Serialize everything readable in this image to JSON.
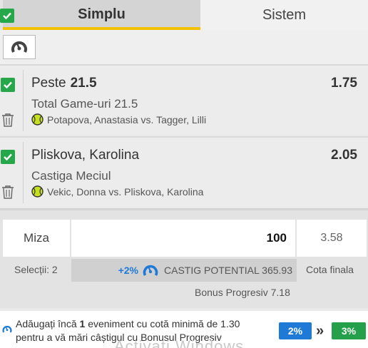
{
  "tabs": {
    "active": "Simplu",
    "inactive": "Sistem"
  },
  "icons": {
    "speed": "speedometer-icon",
    "trash": "trash-icon",
    "sport": "tennis-ball-icon",
    "check": "checkmark-icon",
    "chevron": "double-chevron-right-icon"
  },
  "colors": {
    "accent_yellow": "#f2c200",
    "check_green": "#26a84a",
    "blue": "#1e7ad6",
    "green": "#24a04a",
    "tennis_ball": "#c7e01f"
  },
  "bets": [
    {
      "selection": "Peste",
      "selection_value": "21.5",
      "odds": "1.75",
      "market": "Total Game-uri 21.5",
      "match": "Potapova, Anastasia vs. Tagger, Lilli"
    },
    {
      "selection": "Pliskova, Karolina",
      "selection_value": "",
      "odds": "2.05",
      "market": "Castiga Meciul",
      "match": "Vekic, Donna vs. Pliskova, Karolina"
    }
  ],
  "stake": {
    "label": "Miza",
    "value": "100",
    "total_odds": "3.58",
    "selections": "Selecții: 2",
    "bonus_pct": "+2%",
    "potential": "CASTIG POTENTIAL 365.93",
    "total_odds_label": "Cota finala",
    "progressive_bonus": "Bonus Progresiv 7.18"
  },
  "footer": {
    "msg_before": "Adăugați încă ",
    "msg_count": "1",
    "msg_after": " eveniment cu cotă minimă de 1.30 pentru a vă mări câștigul cu Bonusul Progresiv",
    "current_pct": "2%",
    "next_pct": "3%",
    "chevron": "»"
  },
  "watermark": "Activati Windows"
}
